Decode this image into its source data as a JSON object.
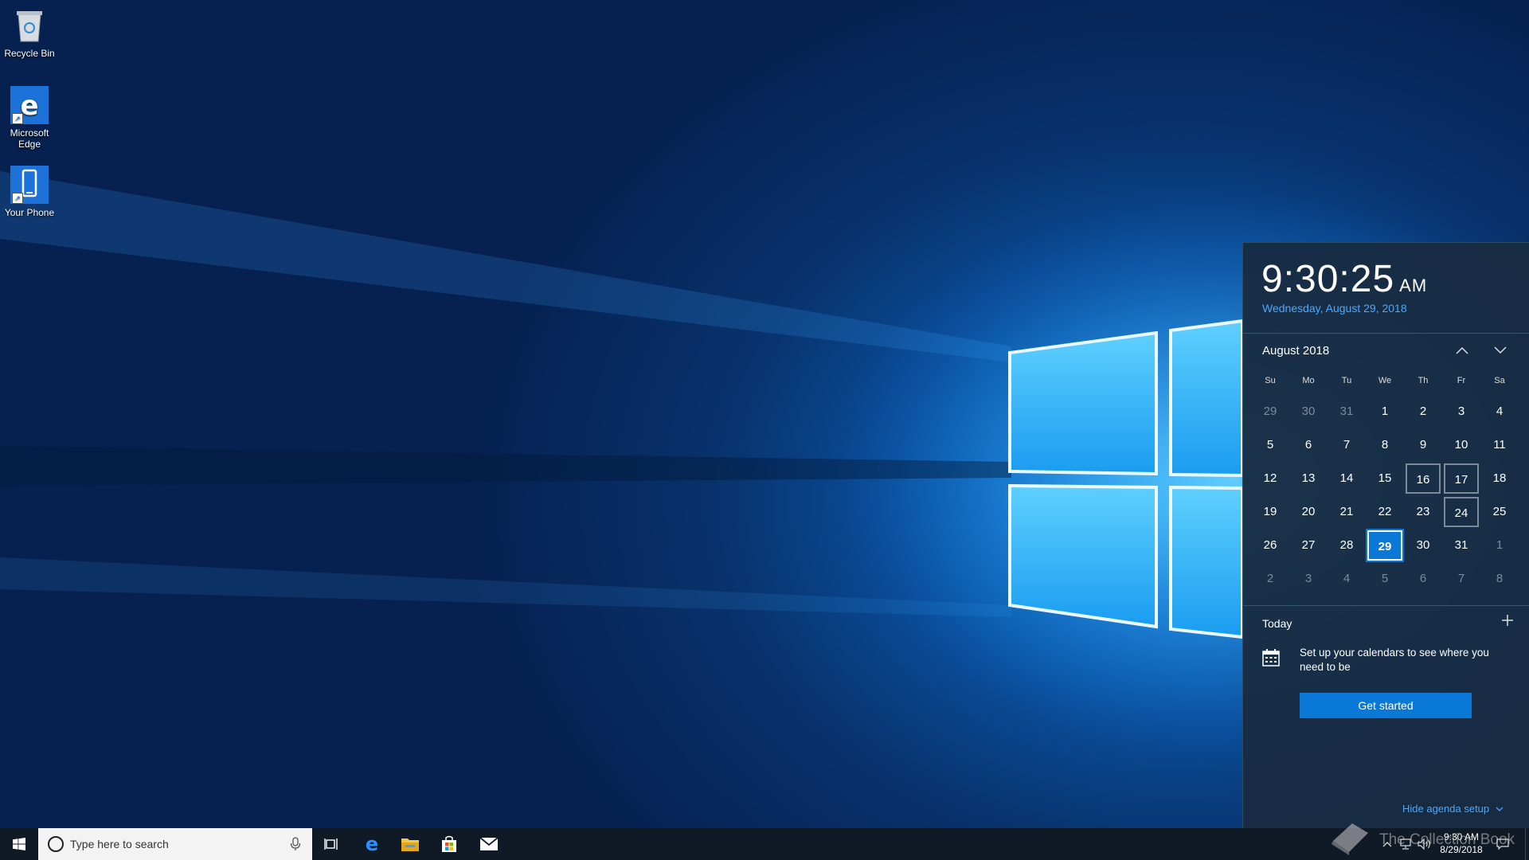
{
  "desktop": {
    "icons": [
      {
        "label": "Recycle Bin"
      },
      {
        "label": "Microsoft\nEdge"
      },
      {
        "label": "Your Phone"
      }
    ]
  },
  "flyout": {
    "time": "9:30:25",
    "ampm": "AM",
    "long_date": "Wednesday, August 29, 2018",
    "month_label": "August 2018",
    "weekdays": [
      "Su",
      "Mo",
      "Tu",
      "We",
      "Th",
      "Fr",
      "Sa"
    ],
    "weeks": [
      [
        "29",
        "30",
        "31",
        "1",
        "2",
        "3",
        "4"
      ],
      [
        "5",
        "6",
        "7",
        "8",
        "9",
        "10",
        "11"
      ],
      [
        "12",
        "13",
        "14",
        "15",
        "16",
        "17",
        "18"
      ],
      [
        "19",
        "20",
        "21",
        "22",
        "23",
        "24",
        "25"
      ],
      [
        "26",
        "27",
        "28",
        "29",
        "30",
        "31",
        "1"
      ],
      [
        "2",
        "3",
        "4",
        "5",
        "6",
        "7",
        "8"
      ]
    ],
    "today_label": "Today",
    "agenda_message": "Set up your calendars to see where you need to be",
    "get_started": "Get started",
    "hide_agenda": "Hide agenda setup"
  },
  "taskbar": {
    "search_placeholder": "Type here to search",
    "clock_time": "9:30 AM",
    "clock_date": "8/29/2018",
    "watermark": "The Collection Book"
  },
  "colors": {
    "accent": "#0a78d7",
    "link": "#4aa8ff",
    "flyout_bg": "#182c42",
    "taskbar_bg": "#101a26"
  }
}
